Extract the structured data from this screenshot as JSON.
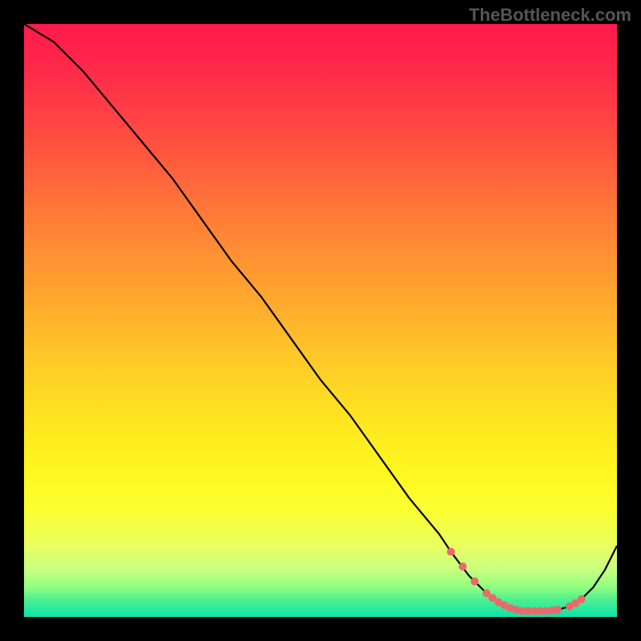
{
  "watermark": "TheBottleneck.com",
  "chart_data": {
    "type": "line",
    "title": "",
    "xlabel": "",
    "ylabel": "",
    "xlim": [
      0,
      100
    ],
    "ylim": [
      0,
      100
    ],
    "series": [
      {
        "name": "curve",
        "x": [
          0,
          5,
          10,
          15,
          20,
          25,
          30,
          35,
          40,
          45,
          50,
          55,
          60,
          65,
          70,
          72,
          75,
          78,
          80,
          82,
          84,
          86,
          88,
          90,
          92,
          94,
          96,
          98,
          100
        ],
        "y": [
          100,
          97,
          92,
          86,
          80,
          74,
          67,
          60,
          54,
          47,
          40,
          34,
          27,
          20,
          14,
          11,
          7,
          4,
          2.5,
          1.5,
          1,
          1,
          1,
          1.2,
          1.8,
          3,
          5,
          8,
          12
        ]
      }
    ],
    "markers": {
      "name": "highlight-points",
      "color": "#e86a6a",
      "x": [
        72,
        74,
        76,
        78,
        79,
        80,
        81,
        82,
        83,
        84,
        85,
        86,
        87,
        88,
        89,
        90,
        92,
        93,
        94
      ],
      "y": [
        11,
        8.5,
        6,
        4,
        3.2,
        2.5,
        2,
        1.5,
        1.2,
        1,
        1,
        1,
        1,
        1,
        1.1,
        1.2,
        1.8,
        2.3,
        3
      ]
    },
    "gradient_stops": [
      {
        "pos": 0,
        "color": "#ff1a4a"
      },
      {
        "pos": 20,
        "color": "#ff5040"
      },
      {
        "pos": 44,
        "color": "#ffa030"
      },
      {
        "pos": 68,
        "color": "#ffe820"
      },
      {
        "pos": 88,
        "color": "#eaff60"
      },
      {
        "pos": 97,
        "color": "#50f090"
      },
      {
        "pos": 100,
        "color": "#10e0b0"
      }
    ]
  }
}
